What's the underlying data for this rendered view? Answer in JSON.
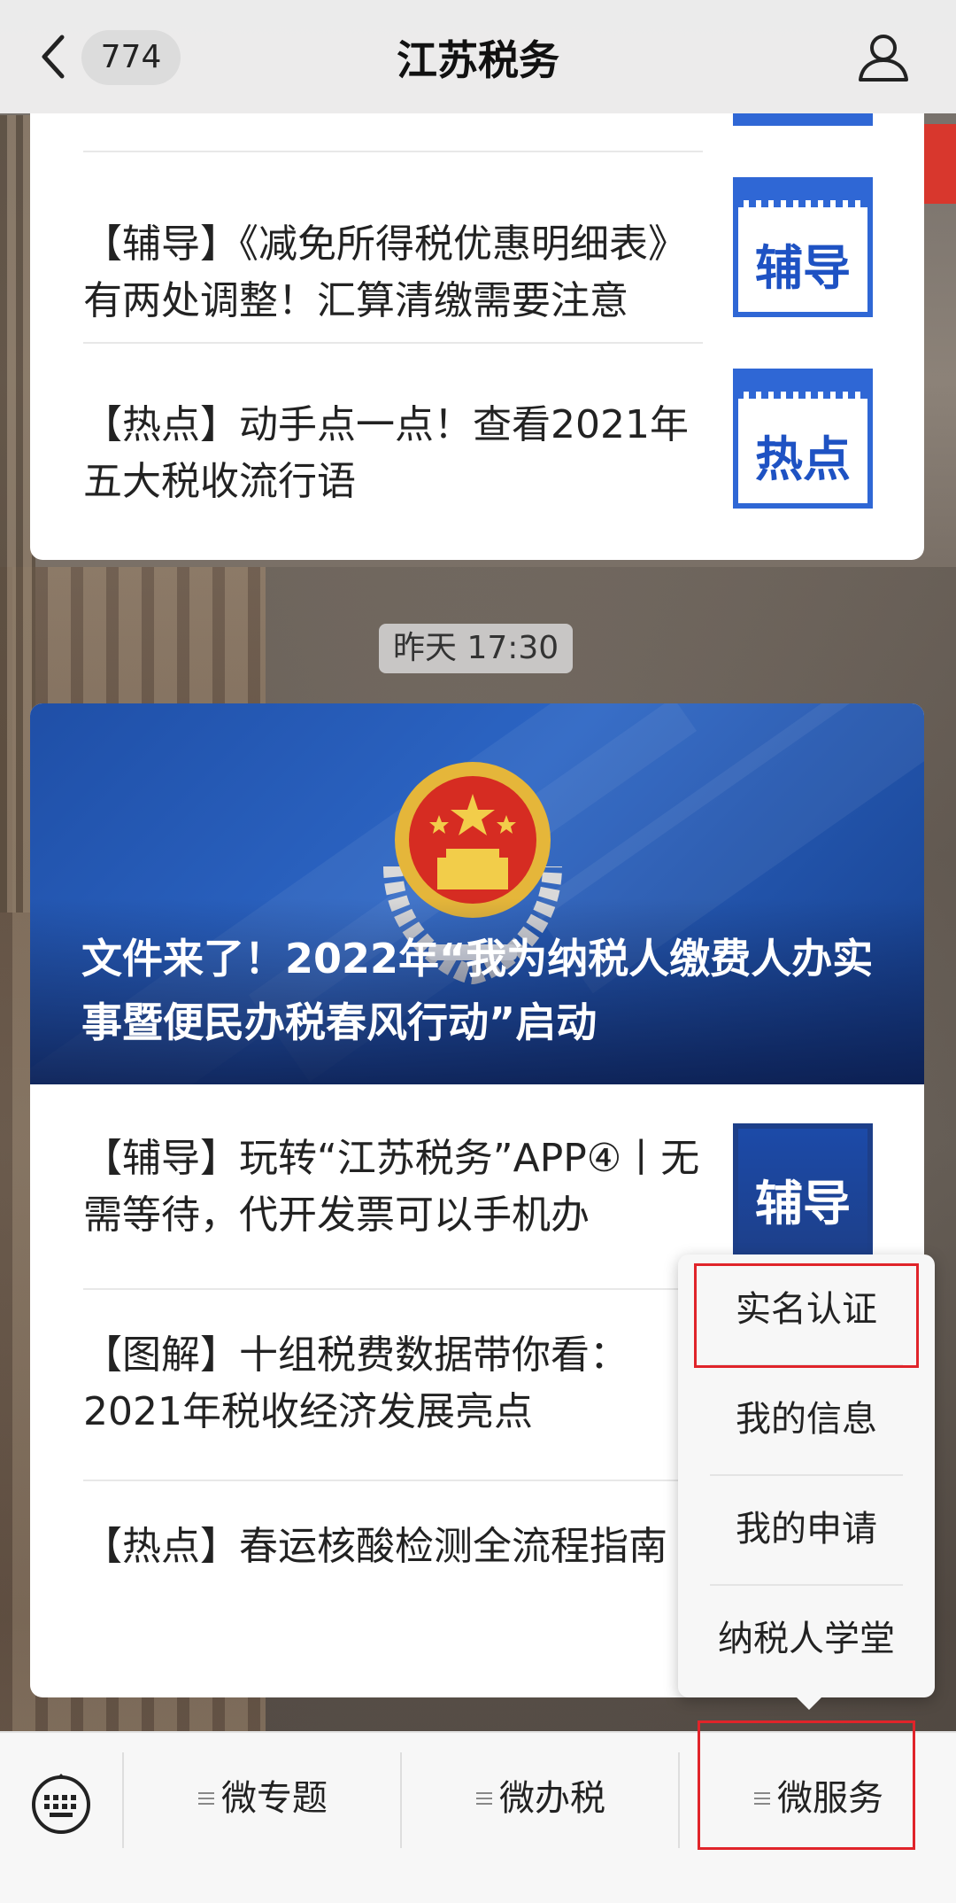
{
  "nav": {
    "unread_count": "774",
    "title": "江苏税务"
  },
  "feed_top": {
    "items": [
      {
        "text": "【辅导】《减免所得税优惠明细表》有两处调整！汇算清缴需要注意",
        "thumb_label": "辅导"
      },
      {
        "text": "【热点】动手点一点！查看2021年五大税收流行语",
        "thumb_label": "热点"
      }
    ]
  },
  "timestamp": "昨天 17:30",
  "feed_main": {
    "hero_title": "文件来了！2022年“我为纳税人缴费人办实事暨便民办税春风行动”启动",
    "items": [
      {
        "text": "【辅导】玩转“江苏税务”APP④丨无需等待，代开发票可以手机办",
        "thumb_label": "辅导"
      },
      {
        "text": "【图解】十组税费数据带你看：2021年税收经济发展亮点"
      },
      {
        "text": "【热点】春运核酸检测全流程指南"
      }
    ]
  },
  "popup_menu": {
    "items": [
      "实名认证",
      "我的信息",
      "我的申请",
      "纳税人学堂"
    ]
  },
  "bottom_tabs": [
    "微专题",
    "微办税",
    "微服务"
  ],
  "colors": {
    "accent_blue": "#2f67d5",
    "highlight_red": "#e0242a"
  }
}
